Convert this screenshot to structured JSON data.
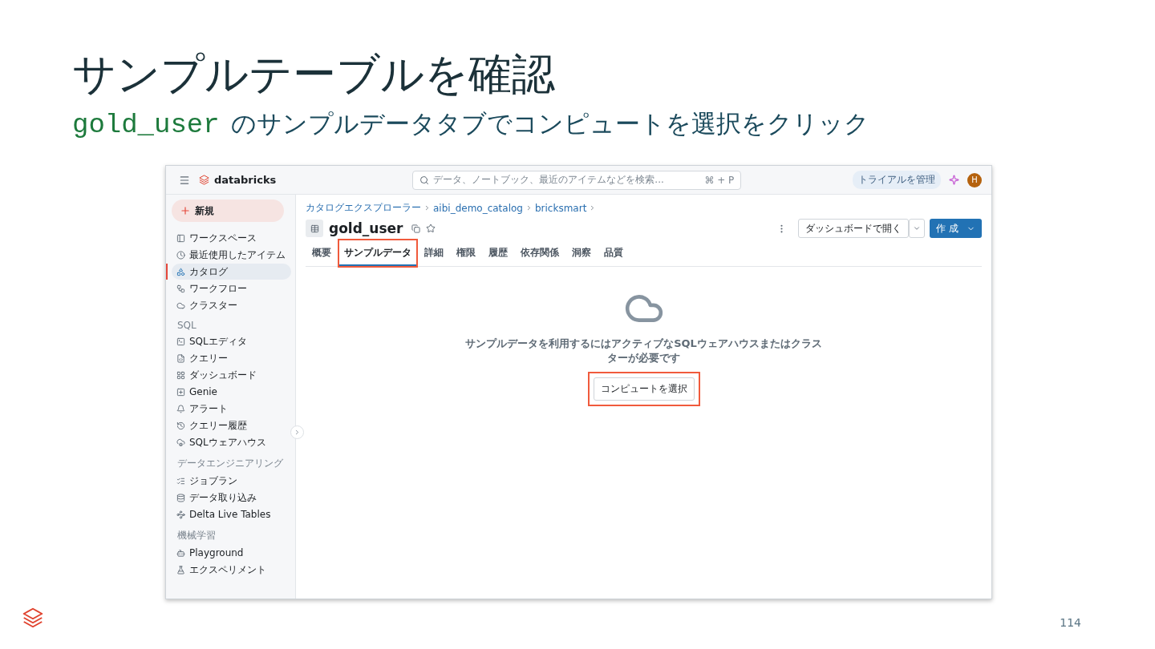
{
  "slide": {
    "title": "サンプルテーブルを確認",
    "subtitle_code": "gold_user",
    "subtitle_text": "のサンプルデータタブでコンピュートを選択をクリック",
    "page_number": "114"
  },
  "top_bar": {
    "logo": "databricks",
    "search": {
      "placeholder": "データ、ノートブック、最近のアイテムなどを検索...",
      "shortcut": "⌘ + P"
    },
    "trial_button": "トライアルを管理",
    "avatar": "H"
  },
  "sidebar": {
    "new_button": "新規",
    "groups": [
      {
        "items": [
          {
            "label": "ワークスペース",
            "selected": false
          },
          {
            "label": "最近使用したアイテム",
            "selected": false
          },
          {
            "label": "カタログ",
            "selected": true
          },
          {
            "label": "ワークフロー",
            "selected": false
          },
          {
            "label": "クラスター",
            "selected": false
          }
        ]
      },
      {
        "heading": "SQL",
        "items": [
          {
            "label": "SQLエディタ",
            "selected": false
          },
          {
            "label": "クエリー",
            "selected": false
          },
          {
            "label": "ダッシュボード",
            "selected": false
          },
          {
            "label": "Genie",
            "selected": false
          },
          {
            "label": "アラート",
            "selected": false
          },
          {
            "label": "クエリー履歴",
            "selected": false
          },
          {
            "label": "SQLウェアハウス",
            "selected": false
          }
        ]
      },
      {
        "heading": "データエンジニアリング",
        "items": [
          {
            "label": "ジョブラン",
            "selected": false
          },
          {
            "label": "データ取り込み",
            "selected": false
          },
          {
            "label": "Delta Live Tables",
            "selected": false
          }
        ]
      },
      {
        "heading": "機械学習",
        "items": [
          {
            "label": "Playground",
            "selected": false
          },
          {
            "label": "エクスペリメント",
            "selected": false
          }
        ]
      }
    ]
  },
  "breadcrumbs": [
    "カタログエクスプローラー",
    "aibi_demo_catalog",
    "bricksmart"
  ],
  "page_title": "gold_user",
  "actions": {
    "open_button": "ダッシュボードで開く",
    "create_button": "作 成"
  },
  "tabs": [
    {
      "label": "概要",
      "selected": false,
      "highlighted": false
    },
    {
      "label": "サンプルデータ",
      "selected": true,
      "highlighted": true
    },
    {
      "label": "詳細",
      "selected": false,
      "highlighted": false
    },
    {
      "label": "権限",
      "selected": false,
      "highlighted": false
    },
    {
      "label": "履歴",
      "selected": false,
      "highlighted": false
    },
    {
      "label": "依存関係",
      "selected": false,
      "highlighted": false
    },
    {
      "label": "洞察",
      "selected": false,
      "highlighted": false
    },
    {
      "label": "品質",
      "selected": false,
      "highlighted": false
    }
  ],
  "empty_state": {
    "message": "サンプルデータを利用するにはアクティブなSQLウェアハウスまたはクラスターが必要です",
    "button": {
      "label": "コンピュートを選択",
      "highlighted": true
    }
  }
}
